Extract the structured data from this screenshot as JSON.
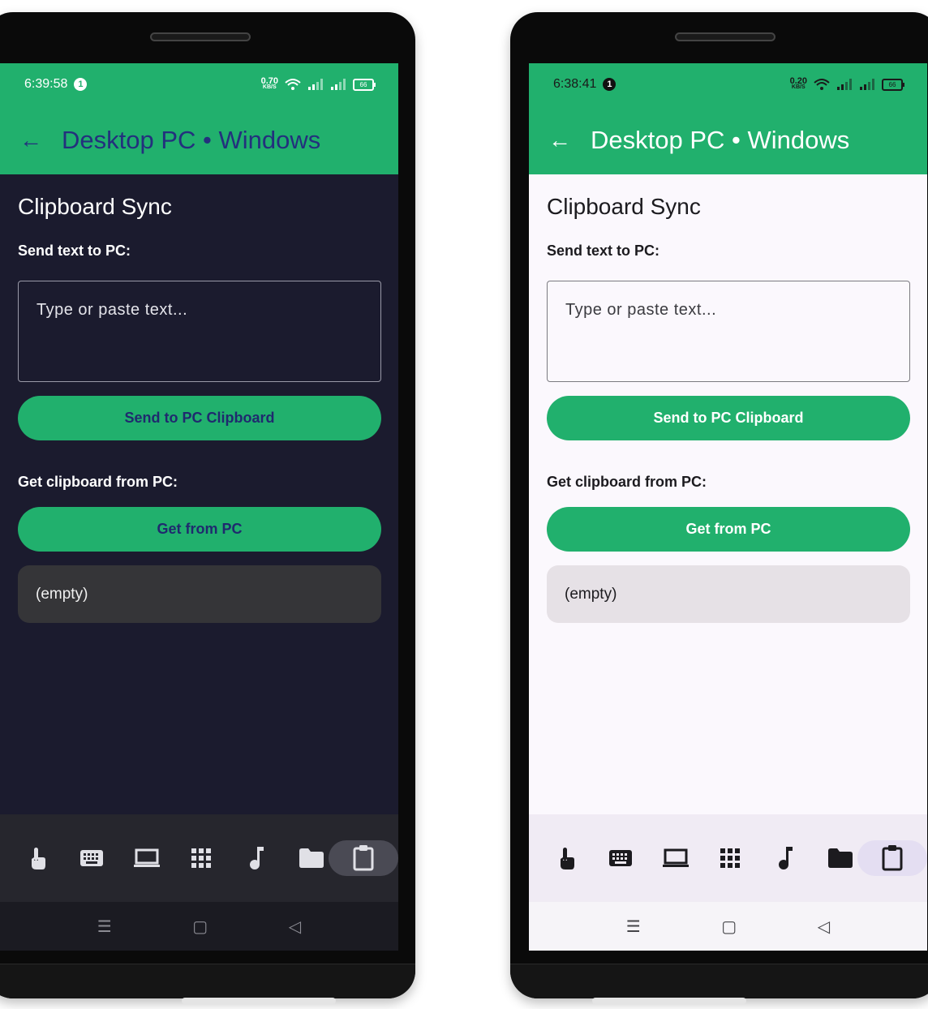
{
  "screens": [
    {
      "theme": "dark",
      "time": "6:39:58",
      "notification_count": "1",
      "net_speed": "0.70",
      "net_unit": "KB/S",
      "battery": "66",
      "app_title": "Desktop PC • Windows",
      "section_title": "Clipboard Sync",
      "send_label": "Send text to PC:",
      "input_placeholder": "Type or paste text...",
      "send_button": "Send to PC Clipboard",
      "get_label": "Get clipboard from PC:",
      "get_button": "Get from PC",
      "result_text": "(empty)"
    },
    {
      "theme": "light",
      "time": "6:38:41",
      "notification_count": "1",
      "net_speed": "0.20",
      "net_unit": "KB/S",
      "battery": "66",
      "app_title": "Desktop PC • Windows",
      "section_title": "Clipboard Sync",
      "send_label": "Send text to PC:",
      "input_placeholder": "Type or paste text...",
      "send_button": "Send to PC Clipboard",
      "get_label": "Get clipboard from PC:",
      "get_button": "Get from PC",
      "result_text": "(empty)"
    }
  ],
  "bottom_nav": [
    {
      "icon": "touch-icon"
    },
    {
      "icon": "keyboard-icon"
    },
    {
      "icon": "laptop-icon"
    },
    {
      "icon": "grid-icon"
    },
    {
      "icon": "music-note-icon"
    },
    {
      "icon": "folder-icon"
    },
    {
      "icon": "clipboard-icon",
      "active": true
    }
  ],
  "colors": {
    "accent": "#21b06d",
    "dark_background": "#1b1b2e",
    "light_background": "#fbf8fd",
    "dark_title": "#23307d"
  }
}
